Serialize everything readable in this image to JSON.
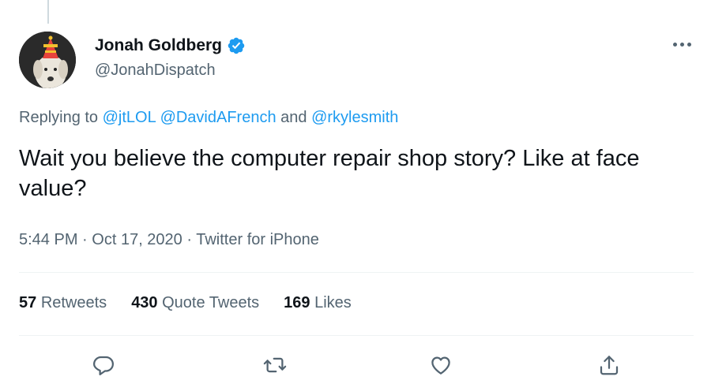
{
  "author": {
    "name": "Jonah Goldberg",
    "handle": "@JonahDispatch",
    "verified": true
  },
  "reply": {
    "prefix": "Replying to",
    "mention_1": "@jtLOL",
    "mention_2": "@DavidAFrench",
    "conjunction": "and",
    "mention_3": "@rkylesmith"
  },
  "tweet": {
    "text": "Wait you believe the computer repair shop story? Like at face value?"
  },
  "meta": {
    "time": "5:44 PM",
    "separator_1": "·",
    "date": "Oct 17, 2020",
    "separator_2": "·",
    "source": "Twitter for iPhone"
  },
  "stats": {
    "retweets_count": "57",
    "retweets_label": "Retweets",
    "quotes_count": "430",
    "quotes_label": "Quote Tweets",
    "likes_count": "169",
    "likes_label": "Likes"
  },
  "actions": {
    "reply_icon": "reply-icon",
    "retweet_icon": "retweet-icon",
    "like_icon": "heart-icon",
    "share_icon": "share-icon"
  },
  "colors": {
    "link": "#1d9bf0",
    "secondary_text": "#536471",
    "primary_text": "#0f1419",
    "divider": "#eff3f4"
  }
}
